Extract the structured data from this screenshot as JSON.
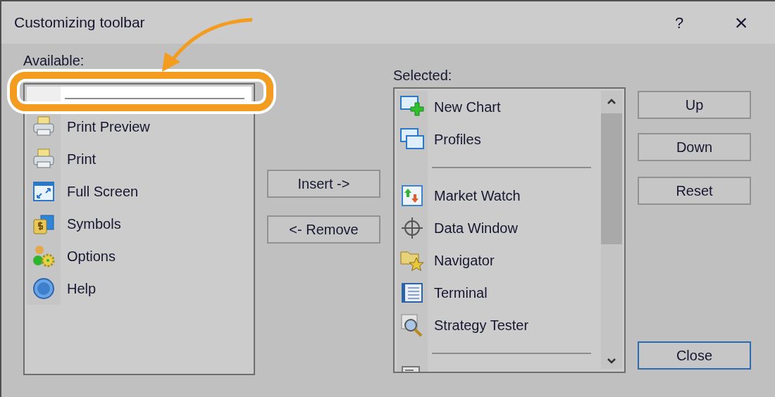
{
  "window": {
    "title": "Customizing toolbar",
    "help": "?",
    "close": "×"
  },
  "available": {
    "label": "Available:",
    "items": [
      {
        "kind": "separator",
        "selected": true
      },
      {
        "kind": "command",
        "label": "Print Preview",
        "selected": false
      },
      {
        "kind": "command",
        "label": "Print",
        "selected": false
      },
      {
        "kind": "command",
        "label": "Full Screen",
        "selected": false
      },
      {
        "kind": "command",
        "label": "Symbols",
        "selected": false
      },
      {
        "kind": "command",
        "label": "Options",
        "selected": false
      },
      {
        "kind": "command",
        "label": "Help",
        "selected": false
      }
    ]
  },
  "transfer_buttons": {
    "insert": "Insert ->",
    "remove": "<- Remove"
  },
  "chosen": {
    "label": "Selected:",
    "items": [
      {
        "kind": "command",
        "label": "New Chart",
        "selected": false
      },
      {
        "kind": "command",
        "label": "Profiles",
        "selected": false
      },
      {
        "kind": "separator",
        "selected": false
      },
      {
        "kind": "command",
        "label": "Market Watch",
        "selected": false
      },
      {
        "kind": "command",
        "label": "Data Window",
        "selected": false
      },
      {
        "kind": "command",
        "label": "Navigator",
        "selected": false
      },
      {
        "kind": "command",
        "label": "Terminal",
        "selected": false
      },
      {
        "kind": "command",
        "label": "Strategy Tester",
        "selected": false
      },
      {
        "kind": "separator",
        "selected": false
      },
      {
        "kind": "command",
        "selected": false
      }
    ]
  },
  "side_buttons": [
    {
      "label": "Up",
      "default": false
    },
    {
      "label": "Down",
      "default": false
    },
    {
      "label": "Reset",
      "default": false
    },
    {
      "label": "Close",
      "default": true
    }
  ]
}
